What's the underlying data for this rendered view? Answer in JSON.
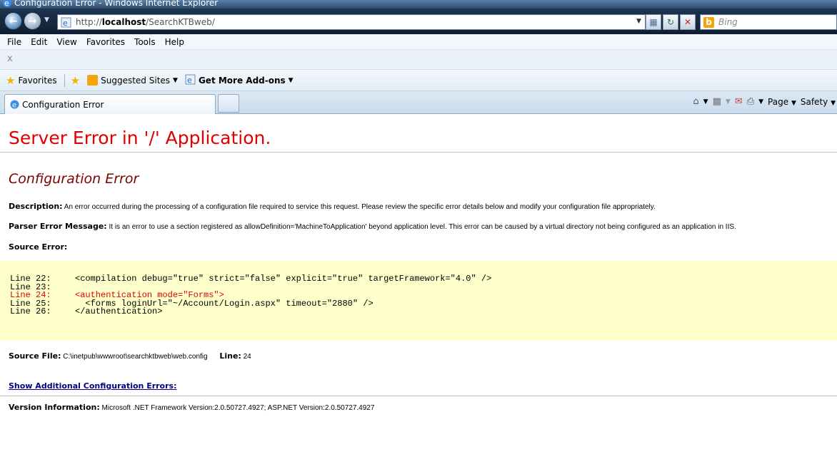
{
  "window": {
    "title": "Configuration Error - Windows Internet Explorer"
  },
  "address": {
    "url_prefix": "http://",
    "url_host": "localhost",
    "url_path": "/SearchKTBweb/"
  },
  "search": {
    "placeholder": "Bing"
  },
  "menu": [
    "File",
    "Edit",
    "View",
    "Favorites",
    "Tools",
    "Help"
  ],
  "commandbar": {
    "close_label": "x"
  },
  "favorites": {
    "favorites_label": "Favorites",
    "suggested_label": "Suggested Sites",
    "addons_label": "Get More Add-ons"
  },
  "tab": {
    "label": "Configuration Error"
  },
  "toolbar": {
    "page_label": "Page",
    "safety_label": "Safety"
  },
  "page": {
    "heading": "Server Error in '/' Application.",
    "subheading": "Configuration Error",
    "description_label": "Description:",
    "description_text": " An error occurred during the processing of a configuration file required to service this request. Please review the specific error details below and modify your configuration file appropriately.",
    "parser_label": "Parser Error Message:",
    "parser_text": " It is an error to use a section registered as allowDefinition='MachineToApplication' beyond application level.  This error can be caused by a virtual directory not being configured as an application in IIS.",
    "source_error_label": "Source Error:",
    "code_lines": [
      {
        "line": "Line 22:",
        "code": "<compilation debug=\"true\" strict=\"false\" explicit=\"true\" targetFramework=\"4.0\" />"
      },
      {
        "line": "Line 23:",
        "code": ""
      },
      {
        "line": "Line 24:",
        "code": "<authentication mode=\"Forms\">"
      },
      {
        "line": "Line 25:",
        "code": "  <forms loginUrl=\"~/Account/Login.aspx\" timeout=\"2880\" />"
      },
      {
        "line": "Line 26:",
        "code": "</authentication>"
      }
    ],
    "source_file_label": "Source File:",
    "source_file_value": " C:\\inetpub\\wwwroot\\searchktbweb\\web.config",
    "line_label": "Line:",
    "line_value": " 24",
    "show_more_link": "Show Additional Configuration Errors:",
    "version_label": "Version Information:",
    "version_text": " Microsoft .NET Framework Version:2.0.50727.4927; ASP.NET Version:2.0.50727.4927"
  },
  "colors": {
    "error_red": "#e00000",
    "subheading": "#800000",
    "code_bg": "#ffffcc",
    "link": "#000080"
  }
}
